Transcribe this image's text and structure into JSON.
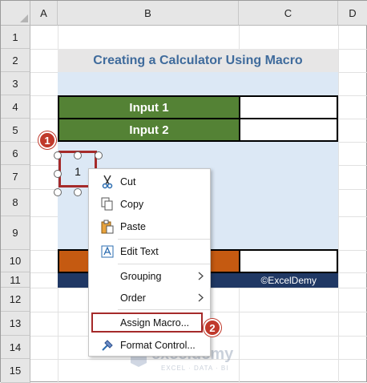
{
  "columns": [
    "A",
    "B",
    "C",
    "D"
  ],
  "rows": [
    "1",
    "2",
    "3",
    "4",
    "5",
    "6",
    "7",
    "8",
    "9",
    "10",
    "11",
    "12",
    "13",
    "14",
    "15"
  ],
  "title": "Creating a Calculator Using Macro",
  "input1_label": "Input 1",
  "input2_label": "Input 2",
  "footer_brand": "©ExcelDemy",
  "button_text": "1",
  "menu": {
    "cut": "Cut",
    "copy": "Copy",
    "paste": "Paste",
    "edit_text": "Edit Text",
    "grouping": "Grouping",
    "order": "Order",
    "assign_macro": "Assign Macro...",
    "format_control": "Format Control..."
  },
  "callouts": {
    "first": "1",
    "second": "2"
  },
  "watermark": {
    "name": "exceldemy",
    "tagline": "EXCEL · DATA · BI"
  },
  "colors": {
    "input_green": "#548235",
    "title_blue_text": "#3f6b9c",
    "orange_fill": "#c55a11",
    "navy_fill": "#203864",
    "callout_red": "#c0392b"
  }
}
